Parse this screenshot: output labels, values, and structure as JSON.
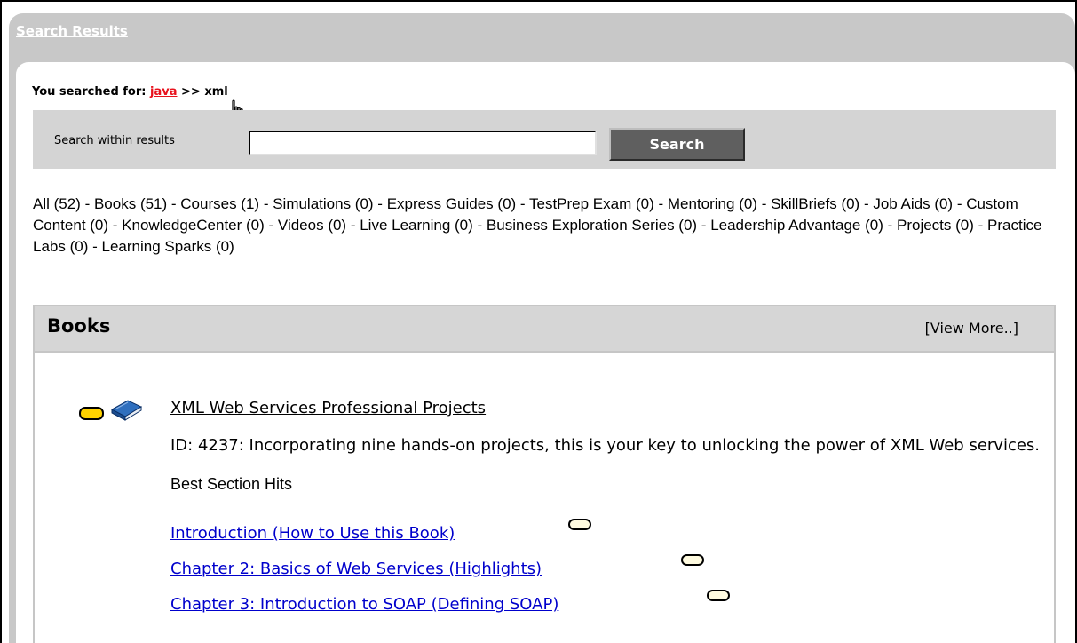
{
  "panel": {
    "title": "Search Results"
  },
  "search": {
    "you_searched_prefix": "You searched for: ",
    "term": "java",
    "separator": " >> xml",
    "within_label": "Search within results",
    "input_value": "",
    "button_label": "Search"
  },
  "filters": [
    {
      "label": "All (52)",
      "link": true,
      "sep": " - "
    },
    {
      "label": "Books (51)",
      "link": true,
      "sep": " - "
    },
    {
      "label": "Courses (1)",
      "link": true,
      "sep": " - "
    },
    {
      "label": "Simulations (0)",
      "link": false,
      "sep": " - "
    },
    {
      "label": "Express Guides (0)",
      "link": false,
      "sep": " - "
    },
    {
      "label": "TestPrep Exam (0)",
      "link": false,
      "sep": " - "
    },
    {
      "label": "Mentoring (0)",
      "link": false,
      "sep": " - "
    },
    {
      "label": "SkillBriefs (0)",
      "link": false,
      "sep": " - "
    },
    {
      "label": "Job Aids (0)",
      "link": false,
      "sep": " - "
    },
    {
      "label": "Custom Content (0)",
      "link": false,
      "sep": " - "
    },
    {
      "label": "KnowledgeCenter (0)",
      "link": false,
      "sep": " - "
    },
    {
      "label": "Videos (0)",
      "link": false,
      "sep": " - "
    },
    {
      "label": "Live Learning (0)",
      "link": false,
      "sep": " - "
    },
    {
      "label": "Business Exploration Series (0)",
      "link": false,
      "sep": " - "
    },
    {
      "label": "Leadership Advantage (0)",
      "link": false,
      "sep": " - "
    },
    {
      "label": "Projects (0)",
      "link": false,
      "sep": " - "
    },
    {
      "label": "Practice Labs (0)",
      "link": false,
      "sep": " - "
    },
    {
      "label": "Learning Sparks (0)",
      "link": false,
      "sep": ""
    }
  ],
  "books": {
    "title": "Books",
    "view_more": "[View More..]",
    "result": {
      "title": "XML Web Services Professional Projects",
      "description": "ID: 4237: Incorporating nine hands-on projects, this is your key to unlocking the power of XML Web services.",
      "hits_label": "Best Section Hits",
      "sections": [
        "Introduction (How to Use this Book)",
        "Chapter 2: Basics of Web Services (Highlights)",
        "Chapter 3: Introduction to SOAP (Defining SOAP)"
      ]
    }
  },
  "colors": {
    "search_term": "#e8121d",
    "section_link": "#0000cc",
    "relevance_fill": "#ffd200",
    "panel_bg": "#c8c8c8"
  }
}
